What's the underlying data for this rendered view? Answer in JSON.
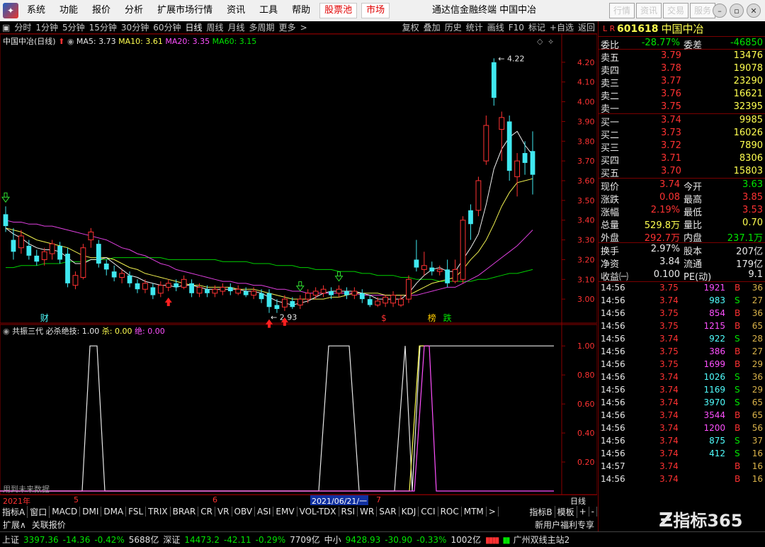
{
  "menubar": {
    "items": [
      "系统",
      "功能",
      "报价",
      "分析",
      "扩展市场行情",
      "资讯",
      "工具",
      "帮助"
    ],
    "hot1": "股票池",
    "hot2": "市场",
    "title": "通达信金融终端  中国中冶",
    "right_buttons": [
      "行情",
      "资讯",
      "交易",
      "服务"
    ]
  },
  "periodbar": {
    "periods": [
      "分时",
      "1分钟",
      "5分钟",
      "15分钟",
      "30分钟",
      "60分钟",
      "日线",
      "周线",
      "月线",
      "多周期",
      "更多"
    ],
    "selected": "日线",
    "tools": [
      "复权",
      "叠加",
      "历史",
      "统计",
      "画线",
      "F10",
      "标记",
      "+自选",
      "返回"
    ]
  },
  "legend": {
    "name": "中国中冶(日线)",
    "ma5": "MA5: 3.73",
    "ma10": "MA10: 3.61",
    "ma20": "MA20: 3.35",
    "ma60": "MA60: 3.15"
  },
  "indicator": {
    "name": "共振三代",
    "bishajueji": "必杀绝技: 1.00",
    "sha": "杀: 0.00",
    "jue": "绝: 0.00",
    "future_note": "用到未来数据"
  },
  "chart_data": [
    {
      "type": "candlestick",
      "ylim": [
        2.9,
        4.3
      ],
      "yticks": [
        "4.20",
        "4.10",
        "4.00",
        "3.90",
        "3.80",
        "3.70",
        "3.60",
        "3.50",
        "3.40",
        "3.30",
        "3.20",
        "3.10",
        "3.00"
      ],
      "high_label": "4.22",
      "low_label": "2.93",
      "candles": [
        {
          "o": 3.43,
          "c": 3.37,
          "h": 3.47,
          "l": 3.34
        },
        {
          "o": 3.3,
          "c": 3.24,
          "h": 3.36,
          "l": 3.2
        },
        {
          "o": 3.26,
          "c": 3.32,
          "h": 3.35,
          "l": 3.23
        },
        {
          "o": 3.27,
          "c": 3.22,
          "h": 3.3,
          "l": 3.2
        },
        {
          "o": 3.22,
          "c": 3.19,
          "h": 3.25,
          "l": 3.17
        },
        {
          "o": 3.2,
          "c": 3.24,
          "h": 3.26,
          "l": 3.17
        },
        {
          "o": 3.23,
          "c": 3.28,
          "h": 3.3,
          "l": 3.2
        },
        {
          "o": 3.27,
          "c": 3.2,
          "h": 3.29,
          "l": 3.18
        },
        {
          "o": 3.23,
          "c": 3.08,
          "h": 3.26,
          "l": 3.06
        },
        {
          "o": 3.07,
          "c": 3.12,
          "h": 3.14,
          "l": 3.05
        },
        {
          "o": 3.11,
          "c": 3.26,
          "h": 3.28,
          "l": 3.1
        },
        {
          "o": 3.3,
          "c": 3.34,
          "h": 3.36,
          "l": 3.26
        },
        {
          "o": 3.28,
          "c": 3.18,
          "h": 3.3,
          "l": 3.16
        },
        {
          "o": 3.18,
          "c": 3.15,
          "h": 3.2,
          "l": 3.12
        },
        {
          "o": 3.14,
          "c": 3.11,
          "h": 3.17,
          "l": 3.09
        },
        {
          "o": 3.11,
          "c": 3.13,
          "h": 3.15,
          "l": 3.08
        },
        {
          "o": 3.12,
          "c": 3.08,
          "h": 3.14,
          "l": 3.06
        },
        {
          "o": 3.08,
          "c": 3.05,
          "h": 3.1,
          "l": 3.03
        },
        {
          "o": 3.05,
          "c": 3.08,
          "h": 3.1,
          "l": 3.03
        },
        {
          "o": 3.06,
          "c": 3.02,
          "h": 3.08,
          "l": 3.0
        },
        {
          "o": 3.03,
          "c": 3.07,
          "h": 3.09,
          "l": 3.01
        },
        {
          "o": 3.06,
          "c": 3.08,
          "h": 3.1,
          "l": 3.04
        },
        {
          "o": 3.08,
          "c": 3.06,
          "h": 3.1,
          "l": 3.04
        },
        {
          "o": 3.06,
          "c": 3.1,
          "h": 3.12,
          "l": 3.05
        },
        {
          "o": 3.08,
          "c": 3.03,
          "h": 3.1,
          "l": 3.01
        },
        {
          "o": 3.03,
          "c": 3.06,
          "h": 3.08,
          "l": 3.01
        },
        {
          "o": 3.05,
          "c": 3.03,
          "h": 3.07,
          "l": 3.01
        },
        {
          "o": 3.03,
          "c": 3.05,
          "h": 3.07,
          "l": 3.01
        },
        {
          "o": 3.04,
          "c": 3.06,
          "h": 3.08,
          "l": 3.02
        },
        {
          "o": 3.06,
          "c": 3.04,
          "h": 3.08,
          "l": 3.02
        },
        {
          "o": 3.03,
          "c": 3.05,
          "h": 3.07,
          "l": 3.02
        },
        {
          "o": 3.04,
          "c": 3.02,
          "h": 3.06,
          "l": 3.01
        },
        {
          "o": 3.02,
          "c": 3.04,
          "h": 3.06,
          "l": 3.0
        },
        {
          "o": 3.03,
          "c": 3.0,
          "h": 3.05,
          "l": 2.98
        },
        {
          "o": 3.03,
          "c": 2.96,
          "h": 3.05,
          "l": 2.93
        },
        {
          "o": 2.97,
          "c": 2.95,
          "h": 3.0,
          "l": 2.93
        },
        {
          "o": 2.96,
          "c": 3.0,
          "h": 3.02,
          "l": 2.94
        },
        {
          "o": 2.99,
          "c": 2.96,
          "h": 3.01,
          "l": 2.95
        },
        {
          "o": 2.97,
          "c": 3.0,
          "h": 3.02,
          "l": 2.95
        },
        {
          "o": 3.0,
          "c": 3.03,
          "h": 3.05,
          "l": 2.98
        },
        {
          "o": 3.02,
          "c": 3.04,
          "h": 3.06,
          "l": 3.0
        },
        {
          "o": 3.03,
          "c": 3.05,
          "h": 3.07,
          "l": 3.01
        },
        {
          "o": 3.04,
          "c": 3.02,
          "h": 3.06,
          "l": 3.0
        },
        {
          "o": 3.03,
          "c": 3.05,
          "h": 3.07,
          "l": 3.01
        },
        {
          "o": 3.04,
          "c": 3.02,
          "h": 3.06,
          "l": 3.0
        },
        {
          "o": 3.02,
          "c": 3.04,
          "h": 3.06,
          "l": 3.0
        },
        {
          "o": 3.03,
          "c": 3.0,
          "h": 3.05,
          "l": 2.98
        },
        {
          "o": 3.0,
          "c": 2.97,
          "h": 3.02,
          "l": 2.96
        },
        {
          "o": 2.97,
          "c": 2.99,
          "h": 3.01,
          "l": 2.96
        },
        {
          "o": 2.98,
          "c": 3.01,
          "h": 3.02,
          "l": 2.96
        },
        {
          "o": 2.98,
          "c": 3.02,
          "h": 3.04,
          "l": 2.96
        },
        {
          "o": 2.97,
          "c": 3.0,
          "h": 3.02,
          "l": 2.96
        },
        {
          "o": 3.0,
          "c": 3.1,
          "h": 3.12,
          "l": 2.98
        },
        {
          "o": 3.2,
          "c": 3.16,
          "h": 3.3,
          "l": 3.14
        },
        {
          "o": 3.15,
          "c": 3.17,
          "h": 3.24,
          "l": 3.12
        },
        {
          "o": 3.16,
          "c": 3.14,
          "h": 3.19,
          "l": 3.12
        },
        {
          "o": 3.14,
          "c": 3.15,
          "h": 3.17,
          "l": 3.12
        },
        {
          "o": 3.15,
          "c": 3.08,
          "h": 3.2,
          "l": 3.06
        },
        {
          "o": 3.09,
          "c": 3.15,
          "h": 3.2,
          "l": 3.08
        },
        {
          "o": 3.1,
          "c": 3.4,
          "h": 3.42,
          "l": 3.08
        },
        {
          "o": 3.45,
          "c": 3.38,
          "h": 3.48,
          "l": 3.3
        },
        {
          "o": 3.45,
          "c": 3.6,
          "h": 3.62,
          "l": 3.42
        },
        {
          "o": 3.7,
          "c": 3.88,
          "h": 3.93,
          "l": 3.68
        },
        {
          "o": 4.2,
          "c": 4.02,
          "h": 4.22,
          "l": 3.98
        },
        {
          "o": 3.86,
          "c": 3.92,
          "h": 3.95,
          "l": 3.7
        },
        {
          "o": 3.9,
          "c": 3.65,
          "h": 3.93,
          "l": 3.6
        },
        {
          "o": 3.62,
          "c": 3.7,
          "h": 3.74,
          "l": 3.52
        },
        {
          "o": 3.74,
          "c": 3.69,
          "h": 3.8,
          "l": 3.63
        },
        {
          "o": 3.75,
          "c": 3.63,
          "h": 3.85,
          "l": 3.53
        }
      ],
      "ma5": [
        3.36,
        3.33,
        3.31,
        3.28,
        3.26,
        3.25,
        3.25,
        3.24,
        3.21,
        3.18,
        3.18,
        3.2,
        3.2,
        3.21,
        3.18,
        3.15,
        3.12,
        3.11,
        3.09,
        3.08,
        3.07,
        3.07,
        3.06,
        3.07,
        3.07,
        3.06,
        3.05,
        3.05,
        3.05,
        3.05,
        3.05,
        3.04,
        3.04,
        3.03,
        3.01,
        2.99,
        2.98,
        2.97,
        2.98,
        2.99,
        3.01,
        3.03,
        3.04,
        3.04,
        3.04,
        3.04,
        3.03,
        3.02,
        3.0,
        3.0,
        3.0,
        3.0,
        3.03,
        3.08,
        3.12,
        3.15,
        3.16,
        3.14,
        3.14,
        3.2,
        3.26,
        3.33,
        3.48,
        3.66,
        3.76,
        3.82,
        3.85,
        3.78,
        3.73
      ],
      "ma10": [
        3.36,
        3.35,
        3.34,
        3.32,
        3.3,
        3.29,
        3.28,
        3.27,
        3.26,
        3.24,
        3.22,
        3.21,
        3.21,
        3.21,
        3.2,
        3.18,
        3.16,
        3.15,
        3.13,
        3.12,
        3.11,
        3.1,
        3.09,
        3.08,
        3.07,
        3.07,
        3.06,
        3.06,
        3.06,
        3.06,
        3.05,
        3.05,
        3.05,
        3.04,
        3.03,
        3.02,
        3.01,
        3.0,
        3.0,
        3.0,
        3.0,
        3.0,
        3.01,
        3.01,
        3.02,
        3.03,
        3.03,
        3.03,
        3.03,
        3.02,
        3.02,
        3.02,
        3.02,
        3.04,
        3.06,
        3.08,
        3.09,
        3.1,
        3.11,
        3.15,
        3.2,
        3.24,
        3.3,
        3.38,
        3.47,
        3.54,
        3.59,
        3.6,
        3.61
      ],
      "ma20": [
        3.4,
        3.39,
        3.39,
        3.38,
        3.38,
        3.37,
        3.37,
        3.36,
        3.35,
        3.34,
        3.33,
        3.32,
        3.31,
        3.3,
        3.28,
        3.26,
        3.25,
        3.23,
        3.22,
        3.2,
        3.18,
        3.17,
        3.15,
        3.14,
        3.13,
        3.12,
        3.11,
        3.1,
        3.09,
        3.09,
        3.08,
        3.08,
        3.07,
        3.07,
        3.06,
        3.05,
        3.05,
        3.04,
        3.04,
        3.03,
        3.03,
        3.03,
        3.03,
        3.03,
        3.03,
        3.03,
        3.02,
        3.02,
        3.02,
        3.02,
        3.02,
        3.02,
        3.02,
        3.02,
        3.03,
        3.04,
        3.05,
        3.06,
        3.06,
        3.08,
        3.1,
        3.12,
        3.15,
        3.18,
        3.21,
        3.24,
        3.27,
        3.31,
        3.35
      ],
      "ma60": [
        3.16,
        3.16,
        3.17,
        3.17,
        3.17,
        3.18,
        3.18,
        3.18,
        3.19,
        3.19,
        3.19,
        3.2,
        3.2,
        3.2,
        3.21,
        3.21,
        3.21,
        3.21,
        3.21,
        3.21,
        3.21,
        3.2,
        3.2,
        3.2,
        3.2,
        3.2,
        3.2,
        3.2,
        3.19,
        3.19,
        3.19,
        3.19,
        3.18,
        3.18,
        3.18,
        3.17,
        3.17,
        3.17,
        3.16,
        3.16,
        3.15,
        3.15,
        3.15,
        3.14,
        3.14,
        3.14,
        3.13,
        3.13,
        3.12,
        3.12,
        3.12,
        3.11,
        3.11,
        3.1,
        3.1,
        3.1,
        3.09,
        3.09,
        3.09,
        3.09,
        3.09,
        3.1,
        3.1,
        3.11,
        3.12,
        3.13,
        3.13,
        3.14,
        3.15
      ],
      "markers": [
        {
          "i": 0,
          "kind": "down-arrow"
        },
        {
          "i": 21,
          "kind": "up-arrow"
        },
        {
          "i": 34,
          "kind": "up-arrow"
        },
        {
          "i": 36,
          "kind": "up-arrow"
        },
        {
          "i": 38,
          "kind": "down-arrow"
        },
        {
          "i": 43,
          "kind": "down-arrow"
        }
      ],
      "flags": [
        {
          "i": 5,
          "text": "财",
          "color": "#50ffff"
        },
        {
          "i": 49,
          "text": "$",
          "color": "#ff3232"
        },
        {
          "i": 55,
          "text": "榜",
          "color": "#ffcc00"
        },
        {
          "i": 57,
          "text": "跌",
          "color": "#00e600"
        }
      ]
    },
    {
      "type": "line",
      "ylim": [
        0,
        1.05
      ],
      "yticks": [
        "1.00",
        "0.80",
        "0.60",
        "0.40",
        "0.20"
      ],
      "series": [
        {
          "name": "必杀绝技",
          "color": "#e8e8e8",
          "points": [
            [
              0,
              0
            ],
            [
              116,
              0
            ],
            [
              127,
              1
            ],
            [
              137,
              1
            ],
            [
              148,
              0
            ],
            [
              450,
              0
            ],
            [
              464,
              1
            ],
            [
              493,
              1
            ],
            [
              507,
              0
            ],
            [
              557,
              0
            ],
            [
              572,
              1
            ],
            [
              582,
              0
            ],
            [
              593,
              1
            ],
            [
              782,
              1
            ]
          ]
        },
        {
          "name": "杀",
          "color": "#ffff50",
          "points": [
            [
              0,
              0
            ],
            [
              578,
              0
            ],
            [
              592,
              1
            ],
            [
              600,
              1
            ],
            [
              605,
              1
            ]
          ]
        },
        {
          "name": "绝",
          "color": "#ff50ff",
          "points": [
            [
              0,
              0
            ],
            [
              585,
              0
            ],
            [
              599,
              1
            ],
            [
              606,
              1
            ],
            [
              616,
              0
            ],
            [
              782,
              0
            ]
          ]
        }
      ]
    }
  ],
  "dates": {
    "d1": "2021年",
    "d2": "5",
    "d3": "6",
    "chip": "2021/06/21/一",
    "d4": "7",
    "period": "日线"
  },
  "tabs": [
    "指标A",
    "窗口",
    "MACD",
    "DMI",
    "DMA",
    "FSL",
    "TRIX",
    "BRAR",
    "CR",
    "VR",
    "OBV",
    "ASI",
    "EMV",
    "VOL-TDX",
    "RSI",
    "WR",
    "SAR",
    "KDJ",
    "CCI",
    "ROC",
    "MTM",
    ">"
  ],
  "tabs_right": [
    "指标B",
    "模板",
    "+",
    "-"
  ],
  "bottom": {
    "left1": "扩展∧",
    "left2": "关联报价",
    "right": "新用户福利专享"
  },
  "status": {
    "sh_label": "上证",
    "sh_val": "3397.36",
    "sh_chg": "-14.36",
    "sh_pct": "-0.42%",
    "sh_amt": "5688亿",
    "sz_label": "深证",
    "sz_val": "14473.2",
    "sz_chg": "-42.11",
    "sz_pct": "-0.29%",
    "sz_amt": "7709亿",
    "zx_label": "中小",
    "zx_val": "9428.93",
    "zx_chg": "-30.90",
    "zx_pct": "-0.33%",
    "zx_amt": "1002亿",
    "site": "广州双线主站2"
  },
  "quote": {
    "code": "601618",
    "name": "中国中冶",
    "lr": "L R",
    "webi_label": "委比",
    "webi_val": "-28.77%",
    "wecha_label": "委差",
    "wecha_val": "-46850",
    "asks": [
      [
        "卖五",
        "3.79",
        "13476"
      ],
      [
        "卖四",
        "3.78",
        "19078"
      ],
      [
        "卖三",
        "3.77",
        "23290"
      ],
      [
        "卖二",
        "3.76",
        "16621"
      ],
      [
        "卖一",
        "3.75",
        "32395"
      ]
    ],
    "bids": [
      [
        "买一",
        "3.74",
        "9985"
      ],
      [
        "买二",
        "3.73",
        "16026"
      ],
      [
        "买三",
        "3.72",
        "7890"
      ],
      [
        "买四",
        "3.71",
        "8306"
      ],
      [
        "买五",
        "3.70",
        "15803"
      ]
    ],
    "stats1": [
      [
        "现价",
        "3.74",
        "今开",
        "3.63"
      ],
      [
        "涨跌",
        "0.08",
        "最高",
        "3.85"
      ],
      [
        "涨幅",
        "2.19%",
        "最低",
        "3.53"
      ],
      [
        "总量",
        "529.8万",
        "量比",
        "0.70"
      ],
      [
        "外盘",
        "292.7万",
        "内盘",
        "237.1万"
      ]
    ],
    "stats2": [
      [
        "换手",
        "2.97%",
        "股本",
        "207亿"
      ],
      [
        "净资",
        "3.84",
        "流通",
        "179亿"
      ],
      [
        "收益㈠",
        "0.100",
        "PE(动)",
        "9.1"
      ]
    ],
    "ticks": [
      [
        "14:56",
        "3.75",
        "1921",
        "B",
        "36"
      ],
      [
        "14:56",
        "3.74",
        "983",
        "S",
        "27"
      ],
      [
        "14:56",
        "3.75",
        "854",
        "B",
        "36"
      ],
      [
        "14:56",
        "3.75",
        "1215",
        "B",
        "65"
      ],
      [
        "14:56",
        "3.74",
        "922",
        "S",
        "28"
      ],
      [
        "14:56",
        "3.75",
        "386",
        "B",
        "27"
      ],
      [
        "14:56",
        "3.75",
        "1699",
        "B",
        "29"
      ],
      [
        "14:56",
        "3.74",
        "1026",
        "S",
        "36"
      ],
      [
        "14:56",
        "3.74",
        "1169",
        "S",
        "29"
      ],
      [
        "14:56",
        "3.74",
        "3970",
        "S",
        "65"
      ],
      [
        "14:56",
        "3.74",
        "3544",
        "B",
        "65"
      ],
      [
        "14:56",
        "3.74",
        "1200",
        "B",
        "56"
      ],
      [
        "14:56",
        "3.74",
        "875",
        "S",
        "37"
      ],
      [
        "14:56",
        "3.74",
        "412",
        "S",
        "16"
      ],
      [
        "14:57",
        "3.74",
        "",
        "B",
        "16"
      ],
      [
        "14:56",
        "3.74",
        "",
        "B",
        "16"
      ]
    ]
  },
  "watermark": "指标365"
}
